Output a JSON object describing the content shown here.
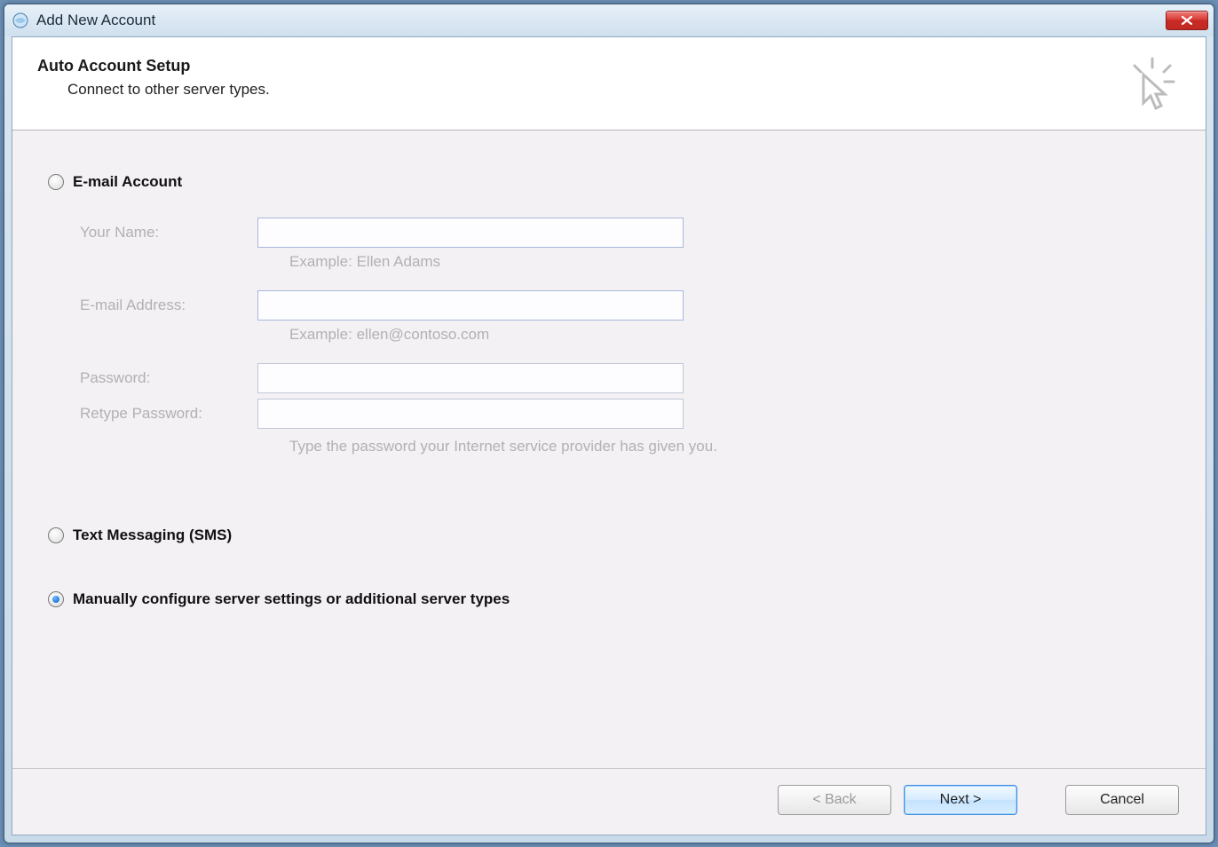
{
  "window": {
    "title": "Add New Account"
  },
  "header": {
    "title": "Auto Account Setup",
    "subtitle": "Connect to other server types."
  },
  "options": {
    "email": {
      "label": "E-mail Account",
      "selected": false
    },
    "sms": {
      "label": "Text Messaging (SMS)",
      "selected": false
    },
    "manual": {
      "label": "Manually configure server settings or additional server types",
      "selected": true
    }
  },
  "form": {
    "name": {
      "label": "Your Name:",
      "value": "",
      "hint": "Example: Ellen Adams"
    },
    "email": {
      "label": "E-mail Address:",
      "value": "",
      "hint": "Example: ellen@contoso.com"
    },
    "password": {
      "label": "Password:",
      "value": ""
    },
    "retype": {
      "label": "Retype Password:",
      "value": ""
    },
    "password_hint": "Type the password your Internet service provider has given you."
  },
  "buttons": {
    "back": "< Back",
    "next": "Next >",
    "cancel": "Cancel"
  }
}
